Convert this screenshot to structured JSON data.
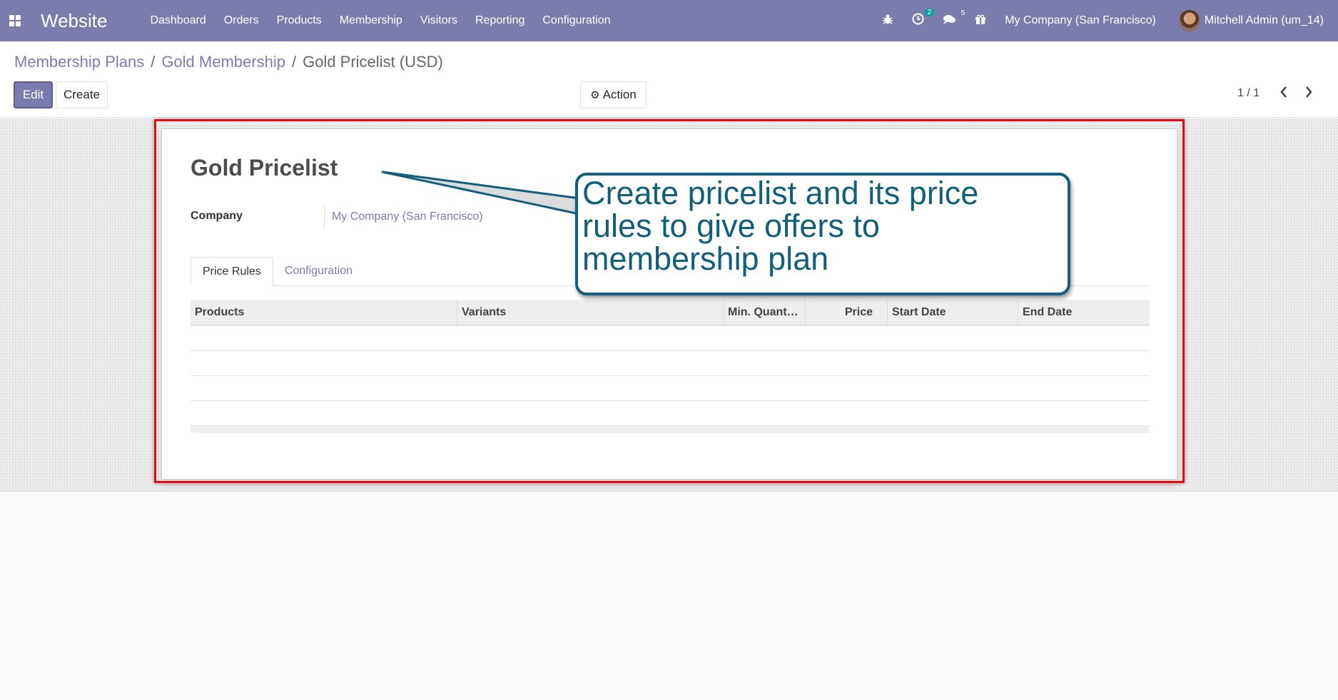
{
  "navbar": {
    "app_name": "Website",
    "menu": [
      "Dashboard",
      "Orders",
      "Products",
      "Membership",
      "Visitors",
      "Reporting",
      "Configuration"
    ],
    "activity_count": "2",
    "message_count": "5",
    "company": "My Company (San Francisco)",
    "user": "Mitchell Admin (um_14)",
    "color": "#7c7bad"
  },
  "breadcrumb": {
    "items": [
      "Membership Plans",
      "Gold Membership"
    ],
    "separator": "/",
    "current": "Gold Pricelist (USD)"
  },
  "buttons": {
    "edit": "Edit",
    "create": "Create",
    "action": "Action"
  },
  "pager": {
    "value": "1 / 1"
  },
  "form": {
    "title": "Gold Pricelist",
    "company_label": "Company",
    "company_value": "My Company (San Francisco)",
    "tabs": [
      "Price Rules",
      "Configuration"
    ],
    "active_tab": "Price Rules",
    "table": {
      "columns": [
        "Products",
        "Variants",
        "Min. Quanti…",
        "Price",
        "Start Date",
        "End Date"
      ],
      "rows": []
    }
  },
  "callout": {
    "line1": "Create pricelist and its price",
    "line2": "rules to give offers to",
    "line3": "membership plan",
    "color": "#125f7c",
    "highlight_color": "#e20a17"
  }
}
